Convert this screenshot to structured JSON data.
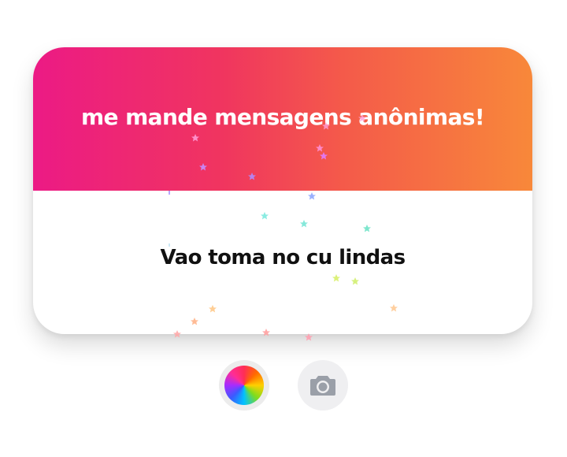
{
  "card": {
    "header_title": "me mande mensagens anônimas!",
    "message": "Vao toma no cu lindas"
  },
  "toolbar": {
    "color_icon": "color-wheel-icon",
    "camera_icon": "camera-icon"
  },
  "colors": {
    "gradient_start": "#ec1a85",
    "gradient_end": "#f8883a",
    "text_dark": "#111111",
    "button_bg": "#ececec"
  }
}
